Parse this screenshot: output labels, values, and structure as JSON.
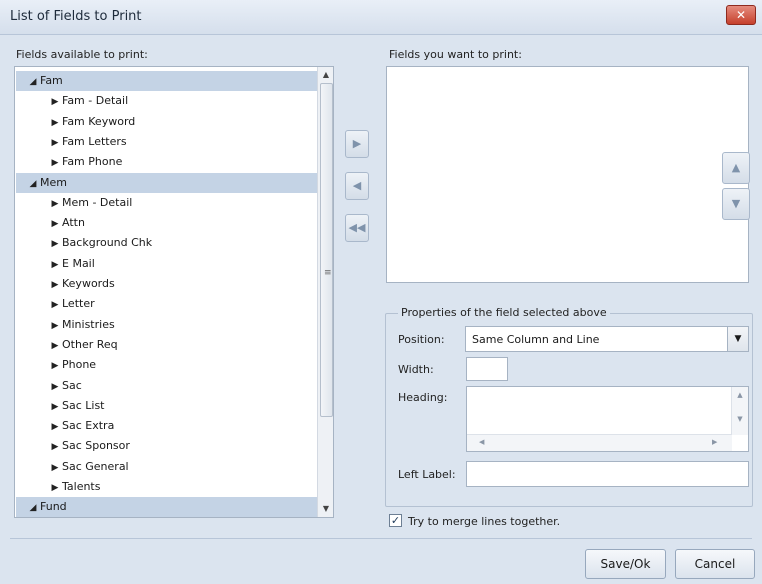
{
  "window": {
    "title": "List of Fields to Print",
    "close_glyph": "✕"
  },
  "available": {
    "label": "Fields available to print:",
    "items": [
      {
        "label": "Fam",
        "type": "group"
      },
      {
        "label": "Fam - Detail",
        "type": "item"
      },
      {
        "label": "Fam Keyword",
        "type": "item"
      },
      {
        "label": "Fam Letters",
        "type": "item"
      },
      {
        "label": "Fam Phone",
        "type": "item"
      },
      {
        "label": "Mem",
        "type": "group"
      },
      {
        "label": "Mem - Detail",
        "type": "item"
      },
      {
        "label": "Attn",
        "type": "item"
      },
      {
        "label": "Background Chk",
        "type": "item"
      },
      {
        "label": "E Mail",
        "type": "item"
      },
      {
        "label": "Keywords",
        "type": "item"
      },
      {
        "label": "Letter",
        "type": "item"
      },
      {
        "label": "Ministries",
        "type": "item"
      },
      {
        "label": "Other Req",
        "type": "item"
      },
      {
        "label": "Phone",
        "type": "item"
      },
      {
        "label": "Sac",
        "type": "item"
      },
      {
        "label": "Sac List",
        "type": "item"
      },
      {
        "label": "Sac Extra",
        "type": "item"
      },
      {
        "label": "Sac Sponsor",
        "type": "item"
      },
      {
        "label": "Sac General",
        "type": "item"
      },
      {
        "label": "Talents",
        "type": "item"
      },
      {
        "label": "Fund",
        "type": "group"
      }
    ]
  },
  "transfer": {
    "add": "▶",
    "remove": "◀",
    "remove_all": "◀◀"
  },
  "selected": {
    "label": "Fields you want to print:",
    "items": []
  },
  "order": {
    "up": "▲",
    "down": "▼"
  },
  "properties": {
    "title": "Properties of the field selected above",
    "position_label": "Position:",
    "position_value": "Same Column and Line",
    "width_label": "Width:",
    "width_value": "",
    "heading_label": "Heading:",
    "heading_value": "",
    "left_label_label": "Left Label:",
    "left_label_value": ""
  },
  "merge": {
    "label": "Try to merge lines together.",
    "checked": true
  },
  "buttons": {
    "save": "Save/Ok",
    "cancel": "Cancel"
  }
}
